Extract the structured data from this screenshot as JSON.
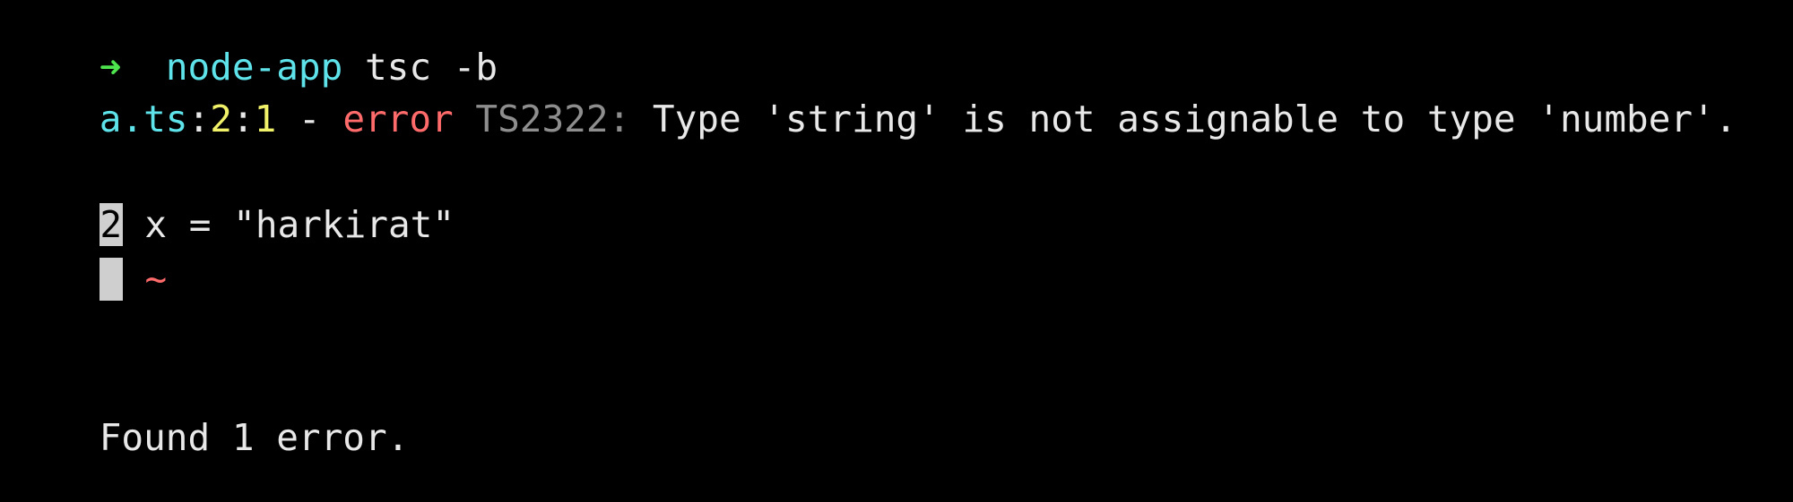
{
  "prompt": {
    "arrow": "➜",
    "directory": "node-app",
    "command": "tsc -b"
  },
  "error": {
    "file": "a.ts",
    "colon1": ":",
    "line": "2",
    "colon2": ":",
    "column": "1",
    "dash": " - ",
    "label": "error",
    "code": "TS2322:",
    "message": "Type 'string' is not assignable to type 'number'."
  },
  "snippet": {
    "line_number": "2",
    "code": " x = \"harkirat\"",
    "underline": "~"
  },
  "summary": {
    "text": "Found 1 error."
  },
  "colors": {
    "background": "#000000",
    "prompt_arrow": "#4ee44e",
    "directory": "#5fe3ea",
    "error_label": "#ff6b6b",
    "line_col": "#f2f26a",
    "error_code": "#8e8e8e",
    "gutter": "#cfcfcf"
  }
}
